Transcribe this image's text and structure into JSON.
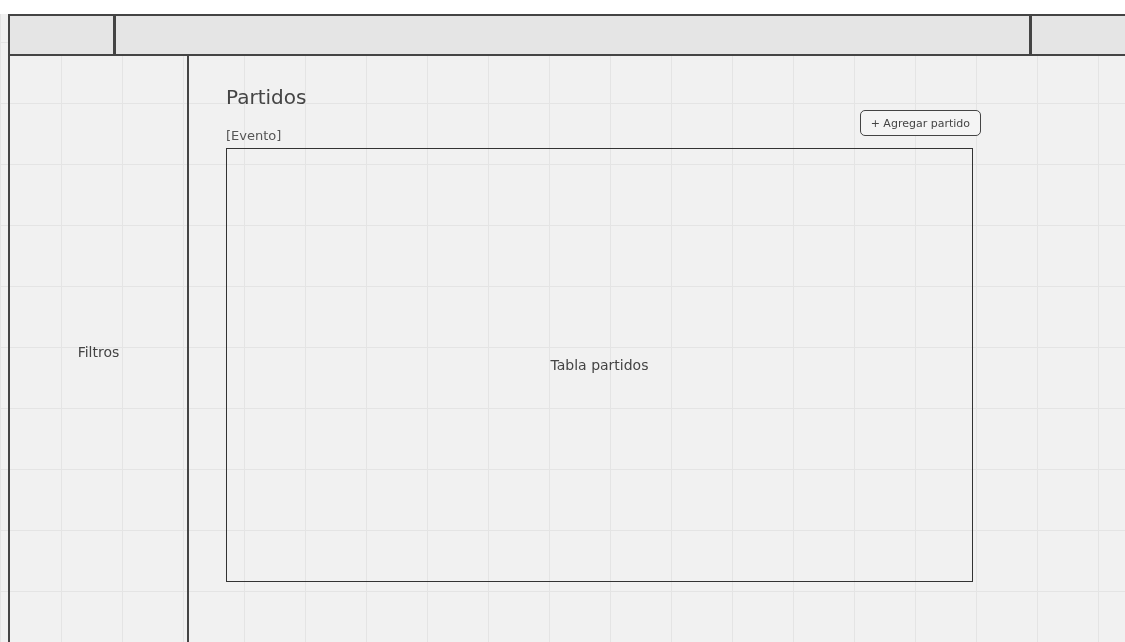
{
  "sidebar": {
    "label": "Filtros"
  },
  "page": {
    "title": "Partidos",
    "subtitle": "[Evento]",
    "add_button": "+ Agregar partido"
  },
  "table": {
    "label": "Tabla partidos"
  }
}
